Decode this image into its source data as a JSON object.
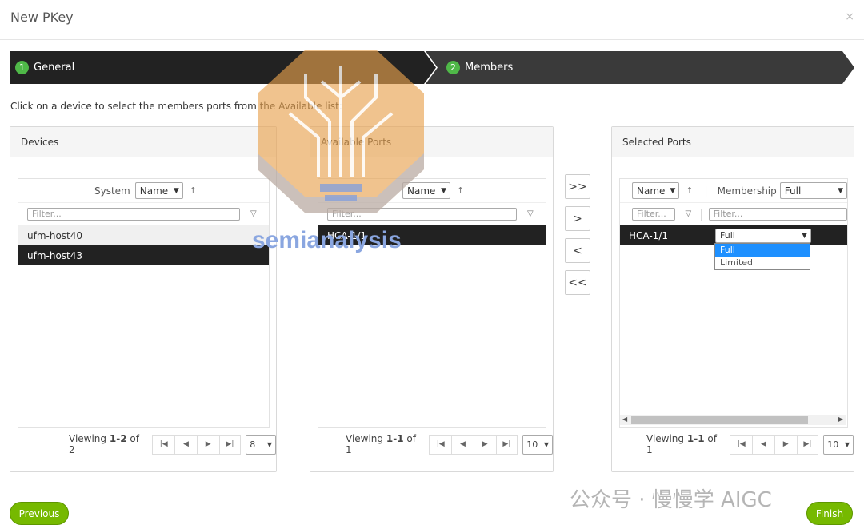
{
  "dialog": {
    "title": "New PKey",
    "close_icon": "×"
  },
  "stepper": {
    "steps": [
      {
        "number": "1",
        "label": "General"
      },
      {
        "number": "2",
        "label": "Members"
      }
    ]
  },
  "instruction": "Click on a device to select the members ports from the Available list:",
  "devices": {
    "title": "Devices",
    "header_label": "System",
    "sort_select": "Name",
    "filter_placeholder": "Filter...",
    "rows": [
      "ufm-host40",
      "ufm-host43"
    ],
    "pager": {
      "prefix": "Viewing ",
      "range": "1-2",
      "of_text": " of 2",
      "page_size": "8"
    }
  },
  "available": {
    "title": "Available Ports",
    "sort_select": "Name",
    "filter_placeholder": "Filter...",
    "rows": [
      "HCA-1/1"
    ],
    "pager": {
      "prefix": "Viewing ",
      "range": "1-1",
      "of_text": " of 1",
      "page_size": "10"
    }
  },
  "move_buttons": {
    "add_all": ">>",
    "add": ">",
    "remove": "<",
    "remove_all": "<<"
  },
  "selected": {
    "title": "Selected Ports",
    "sort_select": "Name",
    "membership_label": "Membership",
    "membership_select": "Full",
    "filter_placeholder": "Filter...",
    "filter2_placeholder": "Filter...",
    "rows": [
      {
        "port": "HCA-1/1",
        "membership": "Full"
      }
    ],
    "dropdown_options": [
      "Full",
      "Limited"
    ],
    "pager": {
      "prefix": "Viewing ",
      "range": "1-1",
      "of_text": " of 1",
      "page_size": "10"
    }
  },
  "footer": {
    "previous": "Previous",
    "finish": "Finish"
  },
  "watermarks": {
    "brand": "semianalysis",
    "wechat": "公众号 · 慢慢学 AIGC"
  },
  "colors": {
    "accent_green": "#76b900",
    "step_green": "#4fb848",
    "stepper_dark": "#222222",
    "selection_blue": "#1e90ff"
  }
}
